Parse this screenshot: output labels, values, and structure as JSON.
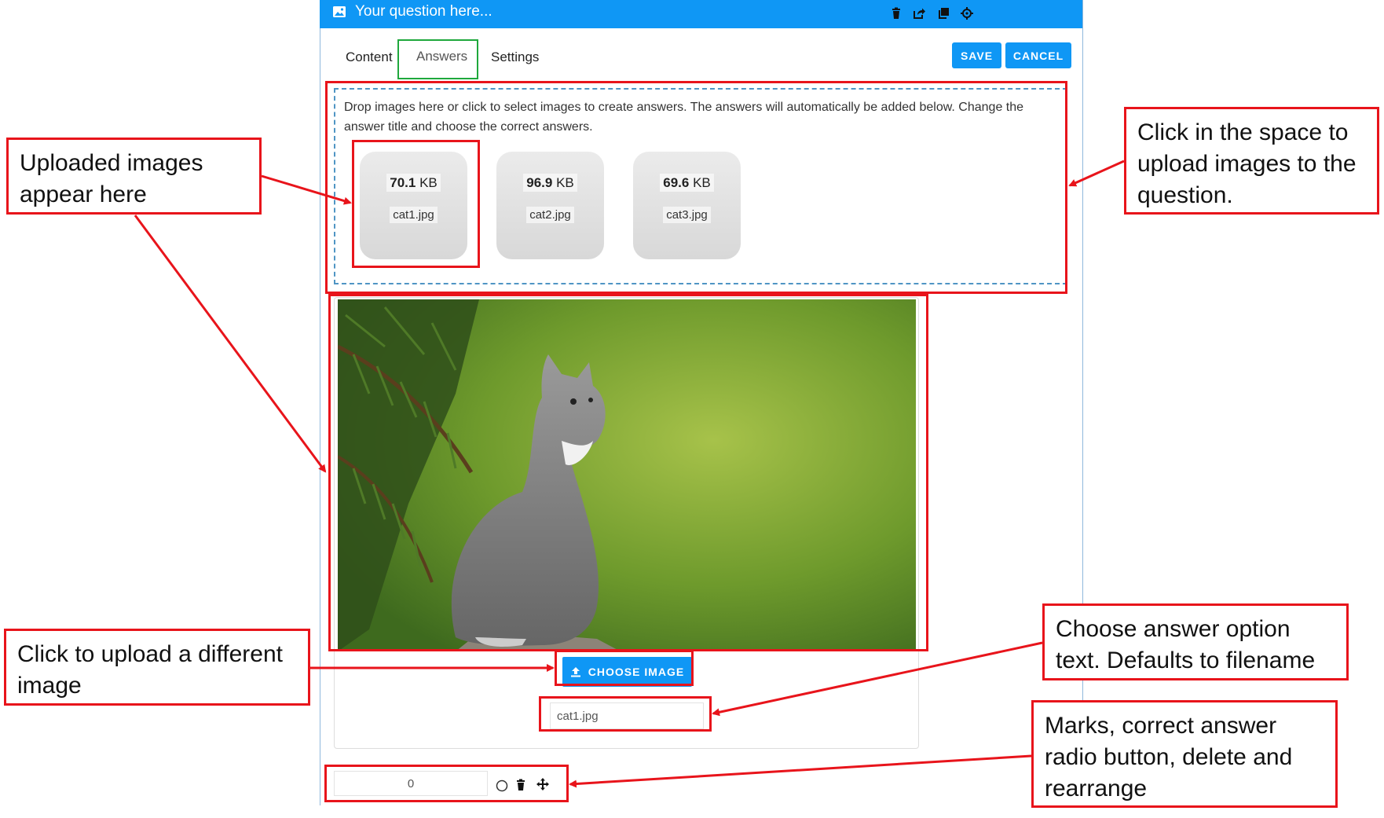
{
  "header": {
    "title": "Your question here...",
    "icons": [
      "image-icon",
      "trash-icon",
      "share-icon",
      "copy-icon",
      "crosshair-icon"
    ]
  },
  "tabs": [
    {
      "label": "Content"
    },
    {
      "label": "Answers",
      "active": true
    },
    {
      "label": "Settings"
    }
  ],
  "actions": {
    "save_label": "SAVE",
    "cancel_label": "CANCEL"
  },
  "dropzone": {
    "instructions": "Drop images here or click to select images to create answers. The answers will automatically be added below. Change the answer title and choose the correct answers."
  },
  "uploads": [
    {
      "size_value": "70.1",
      "size_unit": "KB",
      "filename": "cat1.jpg"
    },
    {
      "size_value": "96.9",
      "size_unit": "KB",
      "filename": "cat2.jpg"
    },
    {
      "size_value": "69.6",
      "size_unit": "KB",
      "filename": "cat3.jpg"
    }
  ],
  "answer": {
    "choose_image_label": "CHOOSE IMAGE",
    "text_value": "cat1.jpg",
    "marks_value": "0"
  },
  "annotations": {
    "uploaded_images": "Uploaded images appear here",
    "click_space": "Click in the space to upload images to the question.",
    "upload_different": "Click to upload a different image",
    "answer_option_text": "Choose answer option text. Defaults to filename",
    "marks_controls": "Marks, correct answer radio button, delete and rearrange"
  },
  "colors": {
    "accent": "#0f97f5",
    "annotation_red": "#e8141b",
    "active_tab_outline": "#1fa83c",
    "dropzone_border": "#4f95c4"
  }
}
